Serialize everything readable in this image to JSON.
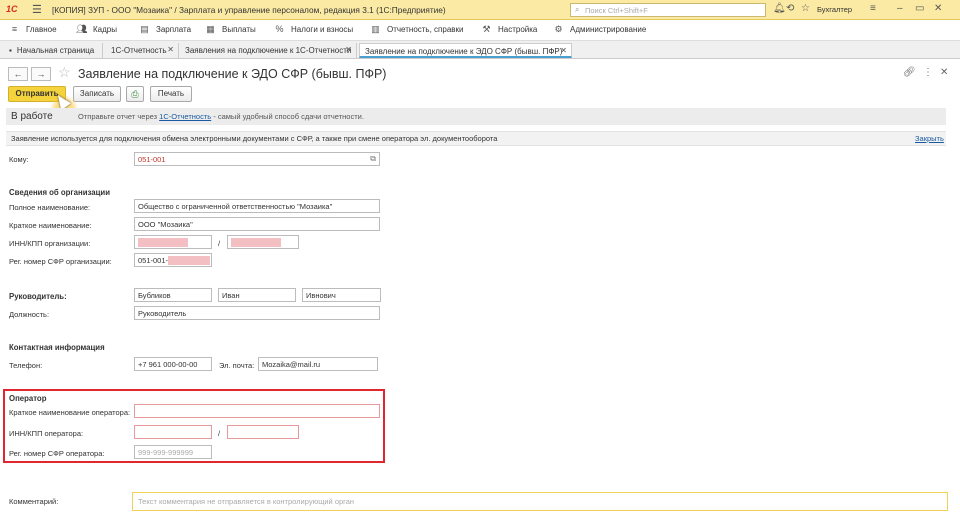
{
  "titlebar": {
    "logo": "1С",
    "title": "[КОПИЯ] ЗУП - ООО \"Мозаика\" / Зарплата и управление персоналом, редакция 3.1  (1С:Предприятие)",
    "search_placeholder": "Поиск Ctrl+Shift+F",
    "user": "Бухгалтер"
  },
  "menu": [
    {
      "label": "Главное",
      "icon": "home-icon"
    },
    {
      "label": "Кадры",
      "icon": "people-icon"
    },
    {
      "label": "Зарплата",
      "icon": "salary-icon"
    },
    {
      "label": "Выплаты",
      "icon": "payments-icon"
    },
    {
      "label": "Налоги и взносы",
      "icon": "percent-icon"
    },
    {
      "label": "Отчетность, справки",
      "icon": "report-icon"
    },
    {
      "label": "Настройка",
      "icon": "wrench-icon"
    },
    {
      "label": "Администрирование",
      "icon": "gear-icon"
    }
  ],
  "tabs": [
    {
      "label": "Начальная страница"
    },
    {
      "label": "1С-Отчетность"
    },
    {
      "label": "Заявления на подключение к 1С-Отчетности"
    },
    {
      "label": "Заявление на подключение к ЭДО СФР (бывш. ПФР)"
    }
  ],
  "form": {
    "title": "Заявление на подключение к ЭДО СФР (бывш. ПФР)",
    "buttons": {
      "send": "Отправить",
      "save": "Записать",
      "print": "Печать"
    },
    "status": "В работе",
    "status_note_prefix": "Отправьте отчет через ",
    "status_note_link": "1С-Отчетность",
    "status_note_suffix": " - самый удобный способ сдачи отчетности.",
    "info": "Заявление используется для подключения обмена электронными документами с СФР, а также при смене оператора эл. документооборота",
    "info_close": "Закрыть"
  },
  "fields": {
    "to_label": "Кому:",
    "to_value": "051-001",
    "org_section": "Сведения об организации",
    "full_name_label": "Полное наименование:",
    "full_name": "Общество с ограниченной ответственностью \"Мозаика\"",
    "short_name_label": "Краткое наименование:",
    "short_name": "ООО \"Мозаика\"",
    "inn_kpp_label": "ИНН/КПП организации:",
    "slash": "/",
    "reg_label": "Рег. номер СФР организации:",
    "reg_prefix": "051-001-",
    "head_label": "Руководитель:",
    "head_last": "Бубликов",
    "head_first": "Иван",
    "head_middle": "Ивнович",
    "position_label": "Должность:",
    "position": "Руководитель",
    "contact_section": "Контактная информация",
    "phone_label": "Телефон:",
    "phone": "+7 961 000-00-00",
    "email_label": "Эл. почта:",
    "email": "Mozaika@mail.ru",
    "operator_section": "Оператор",
    "op_name_label": "Краткое наименование оператора:",
    "op_inn_label": "ИНН/КПП оператора:",
    "op_reg_label": "Рег. номер СФР оператора:",
    "op_reg_placeholder": "999-999-999999",
    "comment_label": "Комментарий:",
    "comment_placeholder": "Текст комментария не отправляется в контролирующий орган"
  }
}
